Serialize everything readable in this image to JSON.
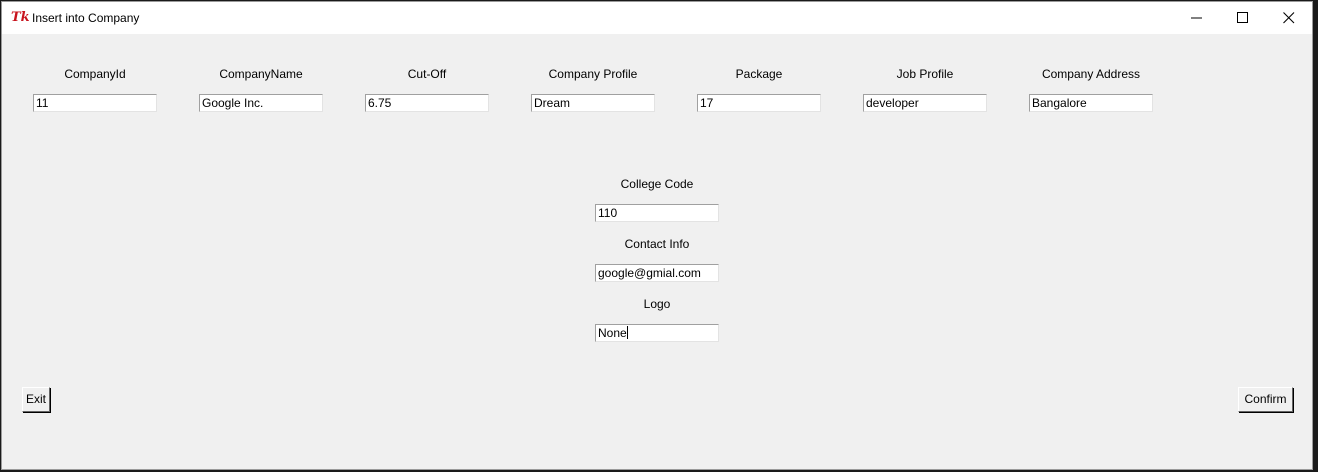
{
  "window": {
    "title": "Insert into Company"
  },
  "fields_row": [
    {
      "label": "CompanyId",
      "value": "11"
    },
    {
      "label": "CompanyName",
      "value": "Google Inc."
    },
    {
      "label": "Cut-Off",
      "value": "6.75"
    },
    {
      "label": "Company Profile",
      "value": "Dream"
    },
    {
      "label": "Package",
      "value": "17"
    },
    {
      "label": "Job Profile",
      "value": "developer"
    },
    {
      "label": "Company Address",
      "value": "Bangalore"
    }
  ],
  "college_code": {
    "label": "College Code",
    "value": "110"
  },
  "contact_info": {
    "label": "Contact Info",
    "value": "google@gmial.com"
  },
  "logo": {
    "label": "Logo",
    "value": "None"
  },
  "buttons": {
    "exit": "Exit",
    "confirm": "Confirm"
  },
  "icons": {
    "app": "tk-feather-icon",
    "minimize": "minimize-icon",
    "maximize": "maximize-icon",
    "close": "close-icon"
  }
}
